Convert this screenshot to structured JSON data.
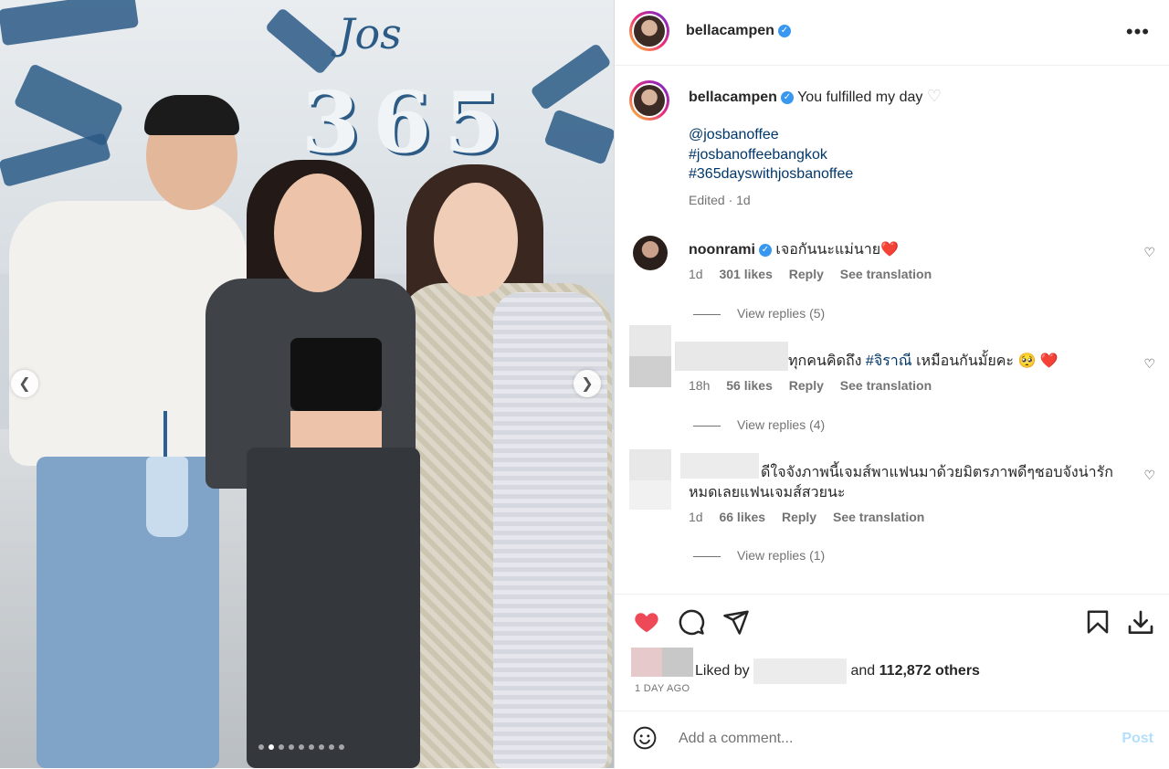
{
  "post": {
    "username": "bellacampen",
    "more_icon": "•••"
  },
  "photo": {
    "sign_text": "365",
    "carousel_dots": 9,
    "active_dot": 1
  },
  "caption": {
    "username": "bellacampen",
    "text": "You fulfilled my day",
    "mention": "@josbanoffee",
    "hashtag1": "#josbanoffeebangkok",
    "hashtag2": "#365dayswithjosbanoffee",
    "edited": "Edited · 1d"
  },
  "comments": [
    {
      "username": "noonrami",
      "text": "เจอกันนะแม่นาย❤️",
      "time": "1d",
      "likes": "301 likes",
      "reply": "Reply",
      "translate": "See translation",
      "view_replies": "View replies (5)"
    },
    {
      "text_prefix": "ทุกคนคิดถึง ",
      "hashtag": "#จิราณี",
      "text_suffix": " เหมือนกันมั้ยคะ 🥺 ❤️",
      "time": "18h",
      "likes": "56 likes",
      "reply": "Reply",
      "translate": "See translation",
      "view_replies": "View replies (4)"
    },
    {
      "line1": "ดีใจจังภาพนี้เจมส์พาแฟนมาด้วยมิตรภาพดีๆชอบจังน่ารัก",
      "line2": "หมดเลยแฟนเจมส์สวยนะ",
      "time": "1d",
      "likes": "66 likes",
      "reply": "Reply",
      "translate": "See translation",
      "view_replies": "View replies (1)"
    }
  ],
  "likes": {
    "prefix": "Liked by",
    "middle": "and",
    "others": "112,872 others",
    "date": "1 DAY AGO"
  },
  "comment_box": {
    "placeholder": "Add a comment...",
    "post_label": "Post"
  },
  "colors": {
    "like_red": "#ed4956",
    "link_blue": "#00376b",
    "verified_blue": "#3897f0"
  }
}
